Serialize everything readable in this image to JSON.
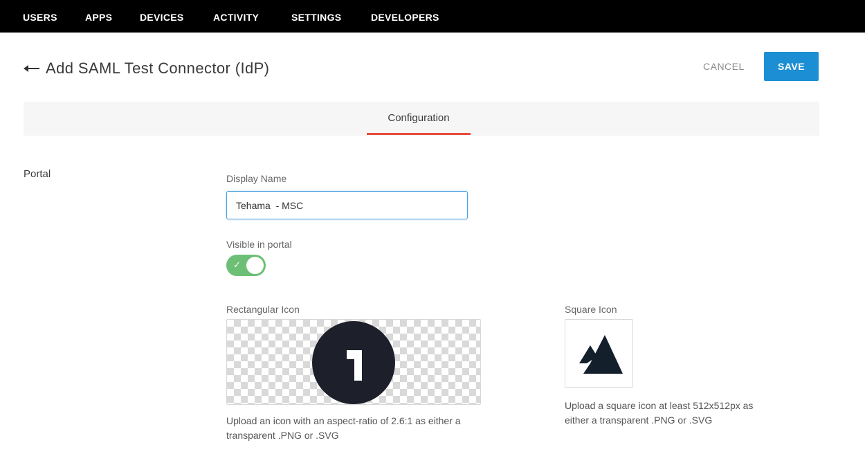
{
  "topnav": {
    "items": [
      "USERS",
      "APPS",
      "DEVICES",
      "ACTIVITY",
      "SETTINGS",
      "DEVELOPERS"
    ]
  },
  "header": {
    "title": "Add SAML Test Connector (IdP)",
    "cancel_label": "CANCEL",
    "save_label": "SAVE"
  },
  "tabs": {
    "active": "Configuration"
  },
  "portal": {
    "section_label": "Portal",
    "display_name_label": "Display Name",
    "display_name_value": "Tehama  - MSC",
    "visible_label": "Visible in portal",
    "visible_on": true,
    "rect_icon_label": "Rectangular Icon",
    "rect_icon_help_line1": "Upload an icon with an aspect-ratio of 2.6:1 as either a",
    "rect_icon_help_line2": "transparent .PNG or .SVG",
    "square_icon_label": "Square Icon",
    "square_icon_help_line1": "Upload a square icon at least 512x512px as",
    "square_icon_help_line2": "either a transparent .PNG or .SVG"
  },
  "colors": {
    "nav_bg": "#000000",
    "accent": "#1c8fd4",
    "tab_underline": "#e84a3f",
    "toggle_on": "#6dbf75"
  },
  "icons": [
    "back-arrow-icon",
    "check-icon",
    "number-one-logo-icon",
    "mountain-logo-icon"
  ]
}
